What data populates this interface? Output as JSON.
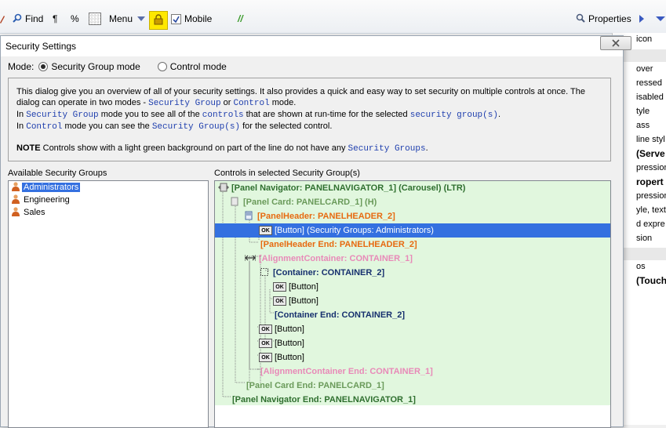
{
  "toolbar": {
    "find_label": "Find",
    "pilcrow_label": "¶",
    "percent_label": "%",
    "menu_label": "Menu",
    "mobile_label": "Mobile",
    "comment_label": "//",
    "properties_label": "Properties"
  },
  "properties_panel": {
    "rows": [
      "icon",
      "over",
      "ressed",
      "isabled",
      "tyle",
      "ass",
      "line styl",
      "(Serve",
      "pression",
      "ropert",
      "pression",
      "yle, text",
      "d expre",
      "sion",
      "os",
      "(Touch"
    ]
  },
  "dialog": {
    "title": "Security Settings",
    "mode_label": "Mode:",
    "mode_options": [
      "Security Group mode",
      "Control mode"
    ],
    "selected_mode": "Security Group mode",
    "info": {
      "line1a": "This dialog give you an overview of all of your security settings. It also provides a quick and easy way to set security on multiple controls at once. The",
      "line2a": "dialog can operate in two modes - ",
      "line2_code1": "Security Group",
      "line2b": " or ",
      "line2_code2": "Control",
      "line2c": " mode.",
      "line3a": "In ",
      "line3_code1": "Security Group",
      "line3b": " mode you to see all of the ",
      "line3_code2": "controls",
      "line3c": " that are shown at run-time for the selected ",
      "line3_code3": "security group(s)",
      "line3d": ".",
      "line4a": "In ",
      "line4_code1": "Control",
      "line4b": " mode you can see the ",
      "line4_code2": "Security Group(s)",
      "line4c": " for the selected control.",
      "note_bold": "NOTE",
      "note_text": " Controls show with a light green background on part of the line do not have any ",
      "note_code": "Security Groups",
      "note_end": "."
    },
    "available_groups_label": "Available Security Groups",
    "groups": [
      "Administrators",
      "Engineering",
      "Sales"
    ],
    "selected_group": "Administrators",
    "controls_label": "Controls in selected Security Group(s)",
    "tree": [
      {
        "text": "[Panel Navigator: PANELNAVIGATOR_1] (Carousel) (LTR)",
        "kind": "nav"
      },
      {
        "text": "[Panel Card: PANELCARD_1]  (H)",
        "kind": "card"
      },
      {
        "text": "[PanelHeader: PANELHEADER_2]",
        "kind": "head"
      },
      {
        "text": "[Button]  (Security Groups: Administrators)",
        "kind": "btn",
        "selected": true
      },
      {
        "text": "[PanelHeader End: PANELHEADER_2]",
        "kind": "head"
      },
      {
        "text": "[AlignmentContainer: CONTAINER_1]",
        "kind": "align"
      },
      {
        "text": "[Container: CONTAINER_2]",
        "kind": "cont"
      },
      {
        "text": "[Button]",
        "kind": "btn"
      },
      {
        "text": "[Button]",
        "kind": "btn"
      },
      {
        "text": "[Container End: CONTAINER_2]",
        "kind": "cont"
      },
      {
        "text": "[Button]",
        "kind": "btn"
      },
      {
        "text": "[Button]",
        "kind": "btn"
      },
      {
        "text": "[Button]",
        "kind": "btn"
      },
      {
        "text": "[AlignmentContainer End: CONTAINER_1]",
        "kind": "align"
      },
      {
        "text": "[Panel Card End: PANELCARD_1]",
        "kind": "card"
      },
      {
        "text": "[Panel Navigator End: PANELNAVIGATOR_1]",
        "kind": "nav"
      }
    ],
    "ok_icon_text": "OK"
  }
}
